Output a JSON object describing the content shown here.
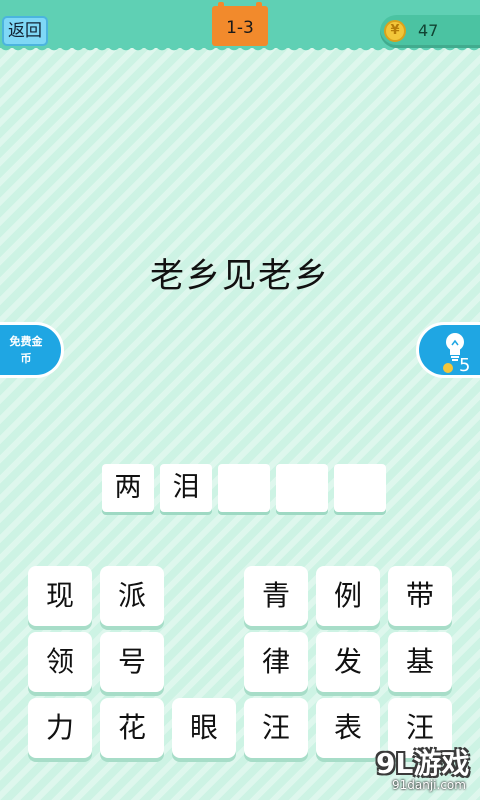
{
  "header": {
    "back_label": "返回",
    "level": "1-3",
    "coins": "47",
    "coin_glyph": "¥"
  },
  "puzzle": {
    "riddle": "老乡见老乡",
    "answer_slots": [
      "两",
      "泪",
      "",
      "",
      ""
    ]
  },
  "side_buttons": {
    "free_coins_label": "免费金币",
    "hint_count": "5"
  },
  "candidates": [
    [
      "现",
      "派",
      "",
      "青",
      "例",
      "带"
    ],
    [
      "领",
      "号",
      "",
      "律",
      "发",
      "基"
    ],
    [
      "力",
      "花",
      "眼",
      "汪",
      "表",
      "汪"
    ]
  ],
  "watermark": {
    "main": "9L游戏",
    "sub": "91danji.com"
  },
  "colors": {
    "background": "#cdf3e4",
    "topbar": "#5fd0b4",
    "level_tab": "#f28a2c",
    "side_button": "#1fa6e3",
    "coin": "#f3c63a"
  }
}
